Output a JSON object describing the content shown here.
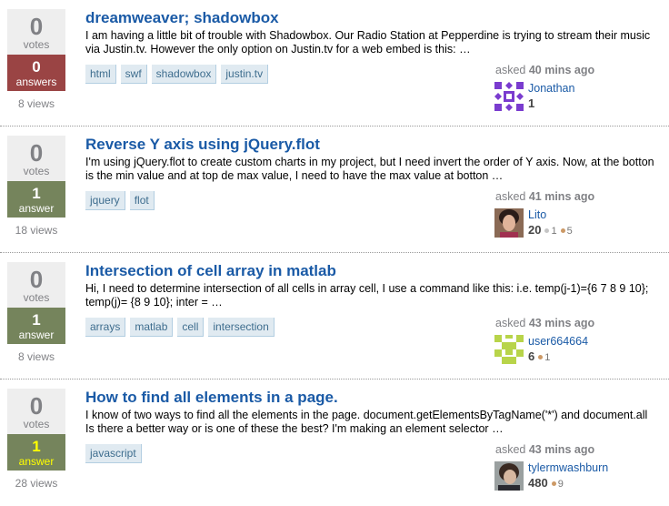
{
  "colors": {
    "link": "#1a5aa6",
    "unanswered": "#9a4444",
    "answered": "#75845c",
    "accepted_text": "#ffff00"
  },
  "questions": [
    {
      "votes": "0",
      "votes_label": "votes",
      "answers": "0",
      "answers_label": "answers",
      "views": "8 views",
      "title": "dreamweaver; shadowbox",
      "excerpt": "I am having a little bit of trouble with Shadowbox. Our Radio Station at Pepperdine is trying to stream their music via Justin.tv. However the only option on Justin.tv for a web embed is this: …",
      "tags": [
        "html",
        "swf",
        "shadowbox",
        "justin.tv"
      ],
      "asked_prefix": "asked",
      "asked_time": "40 mins ago",
      "user": "Jonathan",
      "rep": "1",
      "silver": "",
      "bronze": ""
    },
    {
      "votes": "0",
      "votes_label": "votes",
      "answers": "1",
      "answers_label": "answer",
      "views": "18 views",
      "title": "Reverse Y axis using jQuery.flot",
      "excerpt": "I'm using jQuery.flot to create custom charts in my project, but I need invert the order of Y axis. Now, at the botton is the min value and at top de max value, I need to have the max value at botton …",
      "tags": [
        "jquery",
        "flot"
      ],
      "asked_prefix": "asked",
      "asked_time": "41 mins ago",
      "user": "Lito",
      "rep": "20",
      "silver": "1",
      "bronze": "5"
    },
    {
      "votes": "0",
      "votes_label": "votes",
      "answers": "1",
      "answers_label": "answer",
      "views": "8 views",
      "title": "Intersection of cell array in matlab",
      "excerpt": "Hi, I need to determine intersection of all cells in array cell, I use a command like this: i.e. temp(j-1)={6 7 8 9 10}; temp(j)= {8 9 10}; inter = …",
      "tags": [
        "arrays",
        "matlab",
        "cell",
        "intersection"
      ],
      "asked_prefix": "asked",
      "asked_time": "43 mins ago",
      "user": "user664664",
      "rep": "6",
      "silver": "",
      "bronze": "1"
    },
    {
      "votes": "0",
      "votes_label": "votes",
      "answers": "1",
      "answers_label": "answer",
      "views": "28 views",
      "title": "How to find all elements in a page.",
      "excerpt": "I know of two ways to find all the elements in the page. document.getElementsByTagName('*') and document.all Is there a better way or is one of these the best? I'm making an element selector …",
      "tags": [
        "javascript"
      ],
      "asked_prefix": "asked",
      "asked_time": "43 mins ago",
      "user": "tylermwashburn",
      "rep": "480",
      "silver": "",
      "bronze": "9"
    }
  ]
}
